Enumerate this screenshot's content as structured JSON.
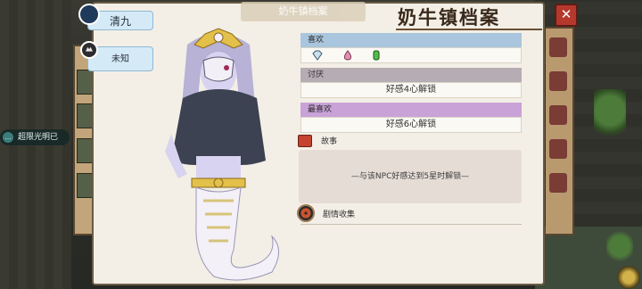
{
  "header": {
    "title": "奶牛镇档案",
    "tab_label": "奶牛镇档案"
  },
  "npc": {
    "name": "清九",
    "status": "未知"
  },
  "likes": {
    "label": "喜欢",
    "items": [
      "diamond-gem-icon",
      "rainbow-droplet-icon",
      "green-potion-icon"
    ]
  },
  "dislikes": {
    "label": "讨厌",
    "locked_text": "好感4心解锁"
  },
  "favorites": {
    "label": "最喜欢",
    "locked_text": "好感6心解锁"
  },
  "story": {
    "label": "故事",
    "locked_text": "—与该NPC好感达到5星时解锁—"
  },
  "plot_collection": {
    "label": "剧情收集"
  },
  "chat": {
    "text": "超限光明已"
  },
  "colors": {
    "likes_header": "#a9c6de",
    "dislikes_header": "#b5adb3",
    "favorites_header": "#c9a2d8",
    "close": "#b5382d"
  }
}
